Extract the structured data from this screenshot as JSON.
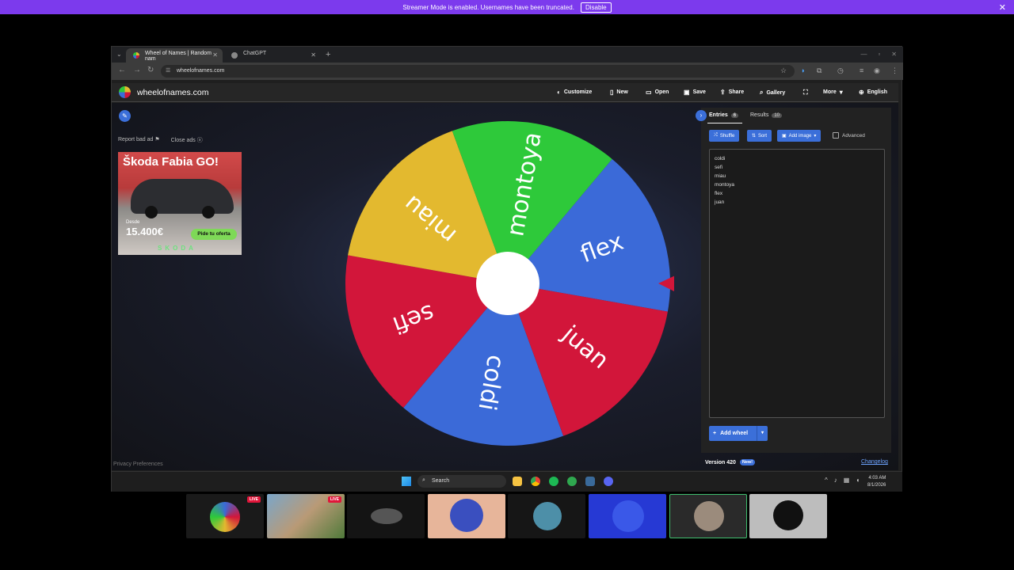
{
  "streamer_bar": {
    "message": "Streamer Mode is enabled. Usernames have been truncated.",
    "button": "Disable",
    "close": "✕"
  },
  "browser": {
    "tabs": [
      {
        "title": "Wheel of Names | Random nam",
        "close": "✕"
      },
      {
        "title": "ChatGPT",
        "close": "✕"
      }
    ],
    "new_tab": "+",
    "url": "wheelofnames.com"
  },
  "site": {
    "name": "wheelofnames.com",
    "menu": {
      "customize": "Customize",
      "new": "New",
      "open": "Open",
      "save": "Save",
      "share": "Share",
      "gallery": "Gallery",
      "more": "More",
      "language": "English"
    },
    "ad": {
      "report": "Report bad ad",
      "close": "Close ads",
      "brand": "Škoda Fabia GO!",
      "desde": "Desde",
      "price": "15.400€",
      "cta": "Pide tu oferta",
      "logo": "SKODA"
    },
    "privacy": "Privacy Preferences"
  },
  "wheel": {
    "segments": [
      {
        "label": "coldi",
        "color": "#3b6ad8"
      },
      {
        "label": "sefi",
        "color": "#d2163a"
      },
      {
        "label": "miau",
        "color": "#e3b92f"
      },
      {
        "label": "montoya",
        "color": "#2ec93a"
      },
      {
        "label": "flex",
        "color": "#3b6ad8"
      },
      {
        "label": "juan",
        "color": "#d2163a"
      }
    ],
    "pointer_color": "#d2163a"
  },
  "sidebar": {
    "entries_tab": "Entries",
    "entries_count": "6",
    "results_tab": "Results",
    "results_count": "10",
    "shuffle": "Shuffle",
    "sort": "Sort",
    "add_image": "Add image",
    "advanced": "Advanced",
    "entries": [
      "coldi",
      "sefi",
      "miau",
      "montoya",
      "flex",
      "juan"
    ],
    "add_wheel": "Add wheel",
    "version": "Version 420",
    "new_badge": "New!",
    "changelog": "Changelog"
  },
  "taskbar": {
    "search": "Search",
    "time": "4:03 AM",
    "date": "8/1/2026"
  },
  "stream_strip": {
    "live_label": "LIVE"
  }
}
